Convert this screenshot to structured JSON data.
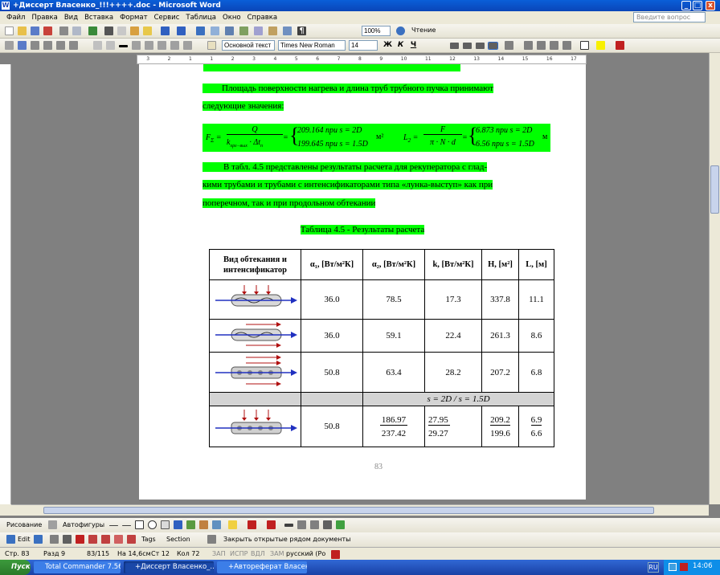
{
  "window": {
    "title": "+Диссерт Власенко_!!!++++.doc - Microsoft Word",
    "min": "_",
    "max": "□",
    "close": "x"
  },
  "menu": [
    "Файл",
    "Правка",
    "Вид",
    "Вставка",
    "Формат",
    "Сервис",
    "Таблица",
    "Окно",
    "Справка"
  ],
  "help_box": "Введите вопрос",
  "toolbar1": {
    "zoom": "100%",
    "reading": "Чтение"
  },
  "toolbar2": {
    "style": "Основной текст",
    "font": "Times New Roman",
    "size": "14",
    "bold": "Ж",
    "italic": "К",
    "underline": "Ч"
  },
  "ruler_marks": [
    "3",
    "2",
    "1",
    "1",
    "2",
    "3",
    "4",
    "5",
    "6",
    "7",
    "8",
    "9",
    "10",
    "11",
    "12",
    "13",
    "14",
    "15",
    "16",
    "17"
  ],
  "doc": {
    "p1": "Площадь поверхности нагрева и длина труб трубного пучка принимают",
    "p1b": "следующие значения:",
    "formula_f": "F",
    "formula_f_sub": "Σ",
    "formula_q": "Q",
    "formula_k": "k",
    "formula_k_sub": "хрл−вых",
    "formula_dt": "Δt",
    "formula_dt_sub": "п",
    "formula_f_case1": "209.164 при s = 2D",
    "formula_f_case2": "199.645 при s = 1.5D",
    "formula_m2": "м²",
    "formula_l": "L",
    "formula_l_sub": "2",
    "formula_l_num": "F",
    "formula_l_den": "π · N · d",
    "formula_l_case1": "6.873 при s = 2D",
    "formula_l_case2": "6.56 при s = 1.5D",
    "formula_m": "м",
    "p2a": "В табл. 4.5 представлены результаты расчета для рекуператора с глад-",
    "p2b": "кими трубами и трубами с интенсификаторами типа «лунка-выступ» как при",
    "p2c": "поперечном, так и при продольном обтекании",
    "caption": "Таблица 4.5 - Результаты расчета",
    "headers": [
      "Вид обтекания и интенсификатор",
      "α₁, [Вт/м²К]",
      "α₂, [Вт/м²К]",
      "k, [Вт/м²К]",
      "H, [м²]",
      "L, [м]"
    ],
    "rows": [
      {
        "a1": "36.0",
        "a2": "78.5",
        "k": "17.3",
        "h": "337.8",
        "l": "11.1"
      },
      {
        "a1": "36.0",
        "a2": "59.1",
        "k": "22.4",
        "h": "261.3",
        "l": "8.6"
      },
      {
        "a1": "50.8",
        "a2": "63.4",
        "k": "28.2",
        "h": "207.2",
        "l": "6.8"
      }
    ],
    "span_label": "s = 2D / s = 1.5D",
    "last_row": {
      "a1": "50.8",
      "a2_top": "186.97",
      "a2_bot": "237.42",
      "k_top": "27.95",
      "k_bot": "29.27",
      "h_top": "209.2",
      "h_bot": "199.6",
      "l_top": "6.9",
      "l_bot": "6.6"
    },
    "page_number": "83"
  },
  "drawbar": {
    "draw": "Рисование",
    "autoshapes": "Автофигуры"
  },
  "tagbar": {
    "edit": "Edit",
    "tags": "Tags",
    "section": "Section",
    "close_docs": "Закрыть открытые рядом документы"
  },
  "status": {
    "page": "Стр. 83",
    "section": "Разд 9",
    "pages": "83/115",
    "at": "На 14,6см",
    "line": "Ст 12",
    "col": "Кол 72",
    "rec": "ЗАП",
    "trk": "ИСПР",
    "ext": "ВДЛ",
    "ovr": "ЗАМ",
    "lang": "русский (Ро"
  },
  "taskbar": {
    "start": "Пуск",
    "tasks": [
      "Total Commander 7.56a ...",
      "+Диссерт Власенко_...",
      "+Автореферат Власен..."
    ],
    "lang": "RU",
    "clock": "14:06"
  }
}
